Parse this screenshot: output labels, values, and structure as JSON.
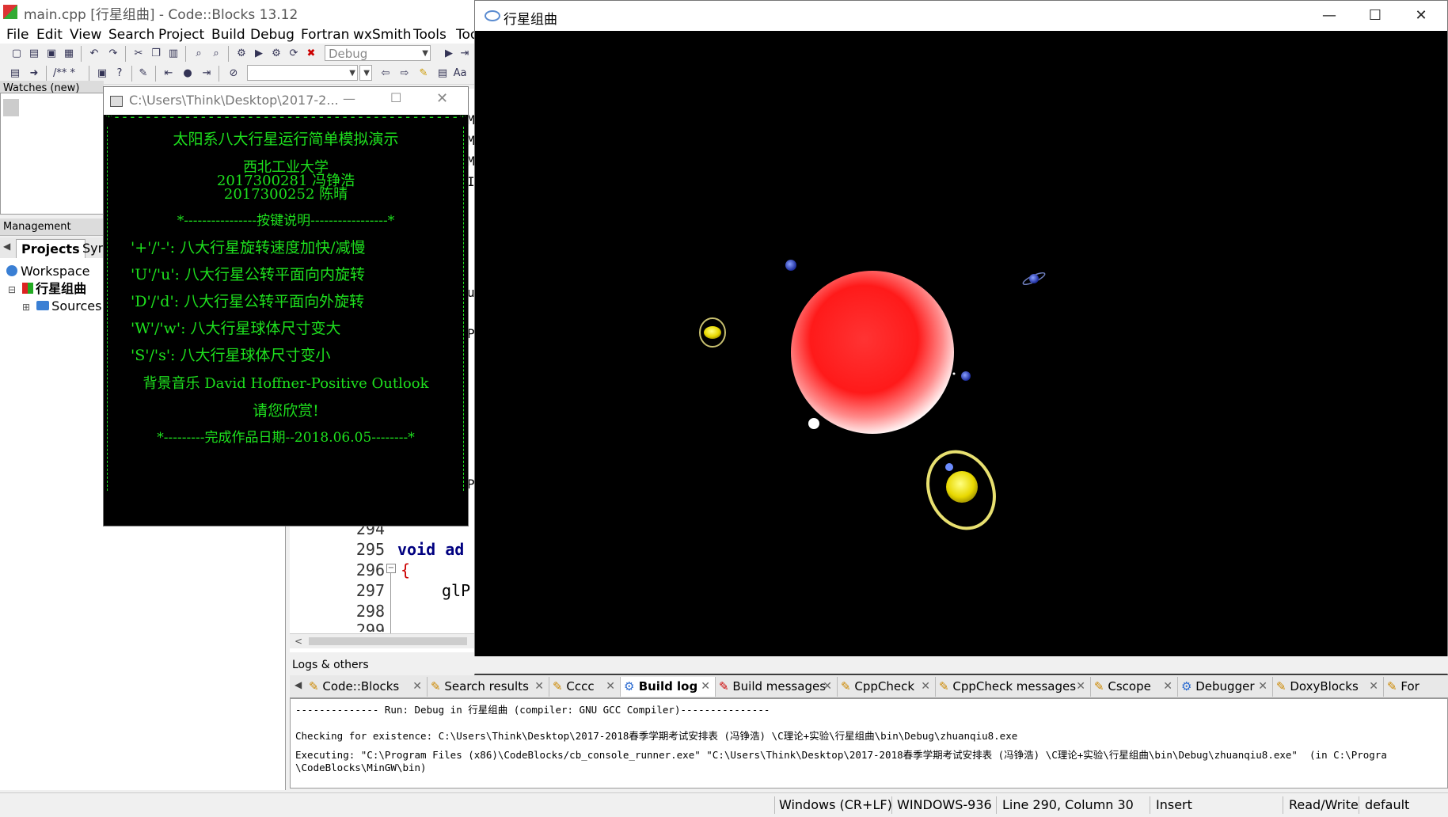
{
  "codeblocks": {
    "title": "main.cpp [行星组曲] - Code::Blocks 13.12",
    "menu": [
      "File",
      "Edit",
      "View",
      "Search",
      "Project",
      "Build",
      "Debug",
      "Fortran",
      "wxSmith",
      "Tools",
      "Too"
    ],
    "build_target": "Debug",
    "watches_label": "Watches (new)",
    "management_label": "Management",
    "mgmt_tabs": [
      "Projects",
      "Sym"
    ],
    "tree": {
      "workspace": "Workspace",
      "project": "行星组曲",
      "sources": "Sources"
    },
    "line_numbers": [
      "294",
      "295",
      "296",
      "297",
      "298",
      "299"
    ],
    "code": {
      "l295": "void ad",
      "l296": "{",
      "l297": "glP"
    },
    "peek_text": [
      "M",
      "M",
      "M",
      "I",
      "u",
      "P",
      "P"
    ]
  },
  "console": {
    "title": "C:\\Users\\Think\\Desktop\\2017-2...",
    "border_top": "*--------------------------------------------*",
    "heading": "太阳系八大行星运行简单模拟演示",
    "school": "西北工业大学",
    "author1": "2017300281 冯铮浩",
    "author2": "2017300252 陈晴",
    "keys_header": "*----------------按键说明-----------------*",
    "key1": "'+'/'-': 八大行星旋转速度加快/减慢",
    "key2": "'U'/'u': 八大行星公转平面向内旋转",
    "key3": "'D'/'d': 八大行星公转平面向外旋转",
    "key4": "'W'/'w': 八大行星球体尺寸变大",
    "key5": "'S'/'s': 八大行星球体尺寸变小",
    "music": "背景音乐 David Hoffner-Positive Outlook",
    "enjoy": "请您欣赏!",
    "footer": "*---------完成作品日期--2018.06.05--------*"
  },
  "gl_window": {
    "title": "行星组曲",
    "min": "—",
    "max": "☐",
    "close": "✕"
  },
  "logs": {
    "header": "Logs & others",
    "tabs": [
      "Code::Blocks",
      "Search results",
      "Cccc",
      "Build log",
      "Build messages",
      "CppCheck",
      "CppCheck messages",
      "Cscope",
      "Debugger",
      "DoxyBlocks",
      "For"
    ],
    "active_tab": "Build log",
    "lines": [
      "-------------- Run: Debug in 行星组曲 (compiler: GNU GCC Compiler)---------------",
      "Checking for existence: C:\\Users\\Think\\Desktop\\2017-2018春季学期考试安排表 (冯铮浩) \\C理论+实验\\行星组曲\\bin\\Debug\\zhuanqiu8.exe",
      "Executing: \"C:\\Program Files (x86)\\CodeBlocks/cb_console_runner.exe\" \"C:\\Users\\Think\\Desktop\\2017-2018春季学期考试安排表 (冯铮浩) \\C理论+实验\\行星组曲\\bin\\Debug\\zhuanqiu8.exe\"  (in C:\\Progra",
      "\\CodeBlocks\\MinGW\\bin)"
    ]
  },
  "status": {
    "eol": "Windows (CR+LF)",
    "encoding": "WINDOWS-936",
    "position": "Line 290, Column 30",
    "mode": "Insert",
    "access": "Read/Write",
    "profile": "default"
  }
}
